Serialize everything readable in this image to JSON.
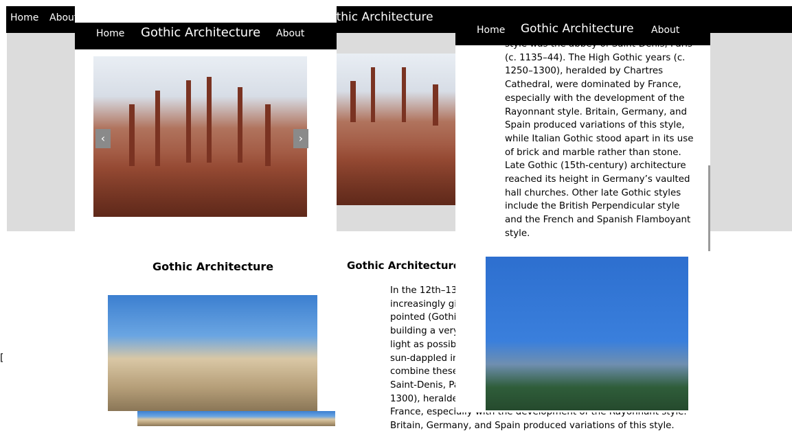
{
  "background_page": {
    "nav": {
      "home": "Home",
      "about": "About"
    },
    "title": "Gothic Architecture",
    "section_title": "Gothic Architecture",
    "text_lines": [
      "In the 12th–13",
      "increasingly gig",
      "pointed (Gothic",
      "building a very",
      "light as possibl",
      "sun-dappled int",
      "combine these",
      "Saint-Denis, Pa",
      "1300), heraldec",
      "France, especially with the development of the Rayonnant style.",
      "Britain, Germany, and Spain produced variations of this style."
    ]
  },
  "window_left": {
    "nav": {
      "home": "Home",
      "title": "Gothic Architecture",
      "about": "About"
    },
    "carousel": {
      "prev": "‹",
      "next": "›"
    },
    "section_title": "Gothic Architecture"
  },
  "window_right": {
    "nav": {
      "home": "Home",
      "title": "Gothic Architecture",
      "about": "About"
    },
    "text_lines": [
      "style was the abbey of Saint-Denis, Paris",
      "(c. 1135–44). The High Gothic years (c.",
      "1250–1300), heralded by Chartres",
      "Cathedral, were dominated by France,",
      "especially with the development of the",
      "Rayonnant style. Britain, Germany, and",
      "Spain produced variations of this style,",
      "while Italian Gothic stood apart in its use",
      "of brick and marble rather than stone.",
      "Late Gothic (15th-century) architecture",
      "reached its height in Germany’s vaulted",
      "hall churches. Other late Gothic styles",
      "include the British Perpendicular style",
      "and the French and Spanish Flamboyant",
      "style."
    ]
  },
  "stray_char": "[",
  "colors": {
    "nav_bg": "#000000",
    "gray_band": "#dcdcdc",
    "arrow_bg": "#8a8a8a"
  }
}
